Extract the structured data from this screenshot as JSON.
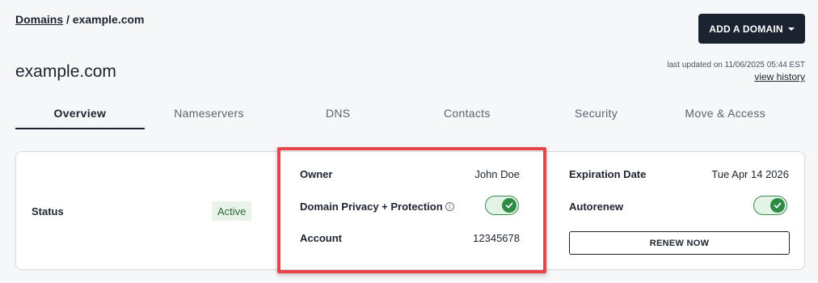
{
  "breadcrumb": {
    "parent": "Domains",
    "separator": " / ",
    "current": "example.com"
  },
  "header": {
    "add_domain_label": "ADD A DOMAIN",
    "title": "example.com"
  },
  "updated": {
    "text": "last updated on 11/06/2025 05:44 EST",
    "history_link": "view history"
  },
  "tabs": [
    {
      "label": "Overview",
      "active": true
    },
    {
      "label": "Nameservers",
      "active": false
    },
    {
      "label": "DNS",
      "active": false
    },
    {
      "label": "Contacts",
      "active": false
    },
    {
      "label": "Security",
      "active": false
    },
    {
      "label": "Move & Access",
      "active": false
    }
  ],
  "overview": {
    "status_label": "Status",
    "status_value": "Active",
    "owner_label": "Owner",
    "owner_value": "John Doe",
    "privacy_label": "Domain Privacy + Protection",
    "privacy_enabled": true,
    "account_label": "Account",
    "account_value": "12345678",
    "expiration_label": "Expiration Date",
    "expiration_value": "Tue Apr 14 2026",
    "autorenew_label": "Autorenew",
    "autorenew_enabled": true,
    "renew_button": "RENEW NOW"
  },
  "colors": {
    "accent_dark": "#1b2331",
    "success": "#2e8b45",
    "highlight": "#e8434a"
  }
}
